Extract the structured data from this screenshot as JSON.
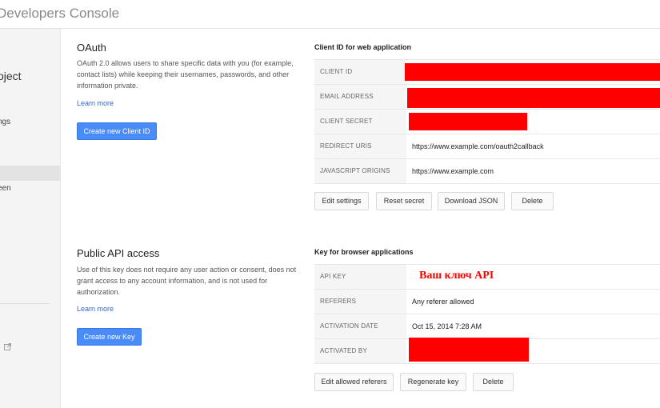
{
  "app": {
    "title": "Developers Console"
  },
  "sidebar": {
    "project_fragment": "oject",
    "settings_fragment": "ngs",
    "screen_fragment": "een",
    "external_link_icon": "external-link-icon"
  },
  "oauth": {
    "title": "OAuth",
    "description": "OAuth 2.0 allows users to share specific data with you (for example, contact lists) while keeping their usernames, passwords, and other information private.",
    "learn_more": "Learn more",
    "create_button": "Create new Client ID"
  },
  "client_web": {
    "title": "Client ID for web application",
    "rows": [
      {
        "key": "CLIENT ID",
        "value": "",
        "redacted": true
      },
      {
        "key": "EMAIL ADDRESS",
        "value": "",
        "redacted": true
      },
      {
        "key": "CLIENT SECRET",
        "value": "",
        "redacted": true
      },
      {
        "key": "REDIRECT URIS",
        "value": "https://www.example.com/oauth2callback"
      },
      {
        "key": "JAVASCRIPT ORIGINS",
        "value": "https://www.example.com"
      }
    ],
    "buttons": {
      "edit": "Edit settings",
      "reset": "Reset secret",
      "download": "Download JSON",
      "delete": "Delete"
    }
  },
  "public_api": {
    "title": "Public API access",
    "description": "Use of this key does not require any user action or consent, does not grant access to any account information, and is not used for authorization.",
    "learn_more": "Learn more",
    "create_button": "Create new Key"
  },
  "browser_key": {
    "title": "Key for browser applications",
    "rows": [
      {
        "key": "API KEY",
        "value": "Ваш ключ API"
      },
      {
        "key": "REFERERS",
        "value": "Any referer allowed"
      },
      {
        "key": "ACTIVATION DATE",
        "value": "Oct 15, 2014 7:28 AM"
      },
      {
        "key": "ACTIVATED BY",
        "value": "",
        "redacted": true
      }
    ],
    "buttons": {
      "edit_referers": "Edit allowed referers",
      "regenerate": "Regenerate key",
      "delete": "Delete"
    }
  },
  "colors": {
    "primary_button": "#4a8cf7",
    "link": "#3366cc",
    "redaction": "#ff0000"
  }
}
